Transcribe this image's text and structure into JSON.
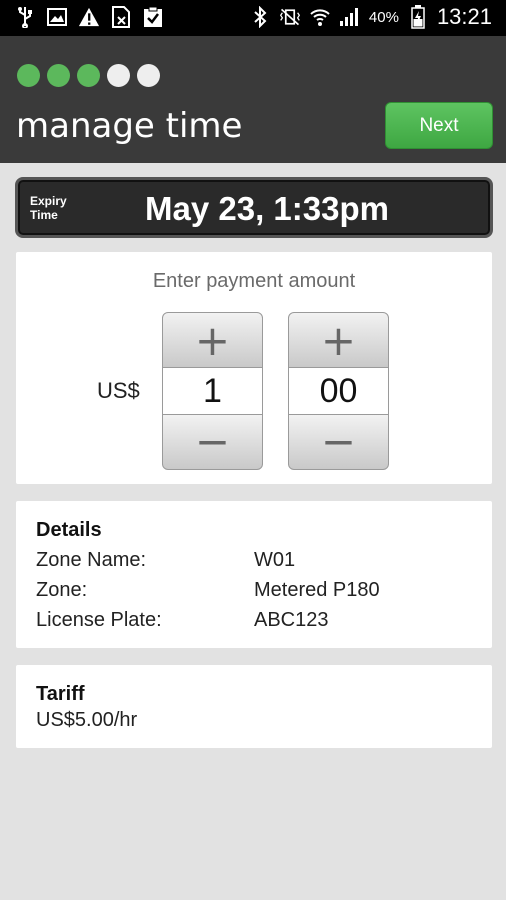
{
  "status_bar": {
    "left_icons": [
      "usb-icon",
      "image-icon",
      "warning-icon",
      "no-sim-icon",
      "clipboard-check-icon"
    ],
    "right_icons": [
      "bluetooth-icon",
      "vibrate-mute-icon",
      "wifi-icon",
      "signal-icon",
      "battery-icon"
    ],
    "battery_percent": "40%",
    "time": "13:21"
  },
  "header": {
    "progress": {
      "total_steps": 5,
      "completed_steps": 3
    },
    "title": "manage time",
    "next_label": "Next"
  },
  "expiry": {
    "label_line1": "Expiry",
    "label_line2": "Time",
    "value": "May 23, 1:33pm"
  },
  "payment": {
    "prompt": "Enter payment amount",
    "currency": "US$",
    "dollars": "1",
    "cents": "00",
    "plus_symbol": "+",
    "minus_symbol": "−"
  },
  "details": {
    "title": "Details",
    "rows": [
      {
        "label": "Zone Name:",
        "value": "W01"
      },
      {
        "label": "Zone:",
        "value": "Metered P180"
      },
      {
        "label": "License Plate:",
        "value": "ABC123"
      }
    ]
  },
  "tariff": {
    "title": "Tariff",
    "rate": "US$5.00/hr"
  },
  "colors": {
    "accent_green": "#5cb85c",
    "header_bg": "#3a3a3a",
    "page_bg": "#e2e2e2"
  }
}
